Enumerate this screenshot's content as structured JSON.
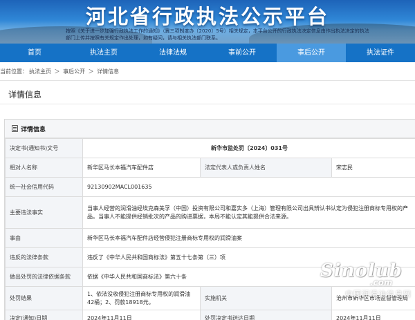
{
  "banner": {
    "title": "河北省行政执法公示平台",
    "notice": "按照《关于进一步加强行政执法工作的通知》（冀三项制度办〔2020〕5号）相关规定，本平台公开的行政执法决定信息由作出执法决定的执法部门上传并按照有关规定作出处理，如有疑问，请与相关执法部门联系。"
  },
  "nav": {
    "items": [
      {
        "label": "首页"
      },
      {
        "label": "执法主页"
      },
      {
        "label": "法律法规"
      },
      {
        "label": "事前公开"
      },
      {
        "label": "事后公开",
        "active": true
      },
      {
        "label": "执法证件"
      }
    ]
  },
  "breadcrumb": {
    "prefix": "当前位置：",
    "items": [
      "执法主页",
      "事后公开",
      "详情信息"
    ],
    "separator": "＞"
  },
  "section": {
    "title": "详情信息"
  },
  "card": {
    "header": "详情信息",
    "rows": {
      "decision_no": {
        "label": "决定书(通知书)文号",
        "value": "新华市监处罚〔2024〕031号"
      },
      "party": {
        "label": "相对人名称",
        "value": "新华区马长本福汽车配件店"
      },
      "legal_rep": {
        "label": "法定代表人或负责人姓名",
        "value": "宋志民"
      },
      "credit_code": {
        "label": "统一社会信用代码",
        "value": "92130902MACL001635"
      },
      "facts": {
        "label": "主要违法事实",
        "value": "当事人经营的润滑油经埃克森美孚（中国）投资有限公司和嘉实多（上海）管理有限公司出具辨认书认定为侵犯注册商标专用权的产品。当事人不能提供经销批次的产品的购进票据，本局不能认定其能提供合法来源。"
      },
      "cause": {
        "label": "事由",
        "value": "新华区马长本福汽车配件店经营侵犯注册商标专用权的润滑油案"
      },
      "law_violated": {
        "label": "违反的法律条款",
        "value": "违反了《中华人民共和国商标法》第五十七条第（三）项"
      },
      "penalty_basis": {
        "label": "做出处罚的法律依据条款",
        "value": "依据《中华人民共和国商标法》第六十条"
      },
      "result": {
        "label": "处罚结果",
        "value": "1、依法没收侵犯注册商标专用权的润滑油42桶；2、罚款18918元。"
      },
      "agency": {
        "label": "实施机关",
        "value": "沧州市新华区市场监督管理局"
      },
      "decision_date": {
        "label": "决定(通知)日期",
        "value": "2024年11月11日"
      },
      "delivery_date": {
        "label": "处罚决定书送达日期",
        "value": "2024年11月11日"
      }
    }
  },
  "watermark": {
    "logo": "Sinolub",
    "domain": ".com",
    "subtitle": "中国润滑油信息网"
  }
}
